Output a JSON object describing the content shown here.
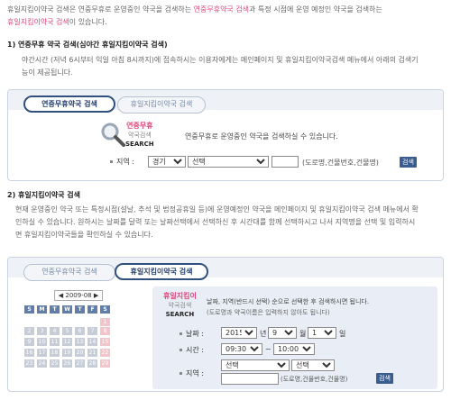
{
  "intro": {
    "line1_a": "휴일지킴이약국 검색은 연중무휴로 운영중인 약국을 검색하는 ",
    "line1_pink": "연중무휴약국 검색",
    "line1_b": "과 특정 시점에 운영 예정인 약국을 검색하는",
    "line2_pink": "휴일지킴이약국 검색",
    "line2_b": "이 있습니다."
  },
  "section1": {
    "title": "1) 연중무휴 약국 검색(심야간 휴일지킴이약국 검색)",
    "body1": "야간시간 (저녁 6시부터 익일 아침 8시까지)에 접속하시는 이용자에게는 메인페이지 및 휴일지킴이약국검색 메뉴에서 아래의 검색기",
    "body2": "능이 제공됩니다."
  },
  "panel1": {
    "tab_active": "연중무휴약국 검색",
    "tab_inactive": "휴일지킴이약국 검색",
    "logo_line1": "연중무휴",
    "logo_line2": "약국검색",
    "logo_line3": "SEARCH",
    "desc": "연중무휴로 운영중인 약국을 검색하실 수 있습니다.",
    "region_label": "지역 :",
    "select1_value": "경기",
    "select2_value": "선택",
    "hint": "(도로명,건물번호,건물명)",
    "search_btn": "검색"
  },
  "section2": {
    "title": "2) 휴일지킴이약국 검색",
    "body1": "현재 운영중인 약국 또는 특정시점(설날, 추석 및 법정공휴일 등)에 운영예정인 약국을 메인페이지 및 휴일지킴이약국 검색 메뉴에서 확",
    "body2": "인하실 수 있습니다. 원하시는 날짜를 달력 또는 날짜선택에서 선택하신 후 시간대를 함께 선택하시고 나서 지역명을 선택 및 입력하시",
    "body3": "면 휴일지킴이약국들을 확인하실 수 있습니다."
  },
  "panel2": {
    "tab_inactive": "연중무휴약국 검색",
    "tab_active": "휴일지킴이약국 검색",
    "calendar": {
      "month": "2009-08",
      "prev": "◀",
      "next": "▶",
      "weekdays": [
        "S",
        "M",
        "T",
        "W",
        "T",
        "F",
        "S"
      ],
      "rows": [
        [
          "",
          "",
          "",
          "",
          "",
          "",
          "1"
        ],
        [
          "2",
          "3",
          "4",
          "5",
          "6",
          "7",
          "8"
        ],
        [
          "9",
          "10",
          "11",
          "12",
          "13",
          "14",
          "15"
        ],
        [
          "16",
          "17",
          "18",
          "19",
          "20",
          "21",
          "22"
        ],
        [
          "23",
          "24",
          "25",
          "26",
          "27",
          "28",
          "29"
        ]
      ]
    },
    "logo_line1": "휴일지킴이",
    "logo_line2": "약국검색",
    "logo_line3": "SEARCH",
    "desc1": "날짜, 지역(반드시 선택) 순으로 선택한 후 검색하시면 됩니다.",
    "desc2": "(도로명과 약국이름은 입력하지 않아도 됩니다)",
    "date_label": "날짜 :",
    "year_value": "2015",
    "year_unit": "년",
    "month_value": "9",
    "month_unit": "월",
    "day_value": "1",
    "day_unit": "일",
    "time_label": "시간 :",
    "time_from": "09:30",
    "time_sep": "~",
    "time_to": "10:00",
    "region_label": "지역 :",
    "region_select1": "선택",
    "region_select2": "선택",
    "hint": "(도로명,건물번호,건물명)",
    "search_btn": "검색"
  }
}
